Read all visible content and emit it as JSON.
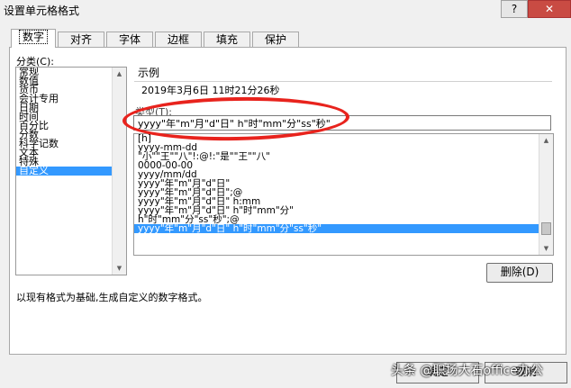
{
  "dialog": {
    "title": "设置单元格格式",
    "help": "?",
    "close": "✕"
  },
  "tabs": [
    "数字",
    "对齐",
    "字体",
    "边框",
    "填充",
    "保护"
  ],
  "category": {
    "label": "分类(C):",
    "items": [
      "常规",
      "数值",
      "货币",
      "会计专用",
      "日期",
      "时间",
      "百分比",
      "分数",
      "科学记数",
      "文本",
      "特殊",
      "自定义"
    ],
    "selected": "自定义"
  },
  "sample": {
    "legend": "示例",
    "value": "2019年3月6日 11时21分26秒"
  },
  "type": {
    "label": "类型(T):",
    "value": "yyyy\"年\"m\"月\"d\"日\" h\"时\"mm\"分\"ss\"秒\""
  },
  "formats": {
    "items": [
      "[h]",
      "yyyy-mm-dd",
      "\"小\"\"王\"\"八\"!:@!:\"是\"\"王\"\"八\"",
      "0000-00-00",
      "yyyy/mm/dd",
      "yyyy\"年\"m\"月\"d\"日\"",
      "yyyy\"年\"m\"月\"d\"日\";@",
      "yyyy\"年\"m\"月\"d\"日\" h:mm",
      "yyyy\"年\"m\"月\"d\"日\" h\"时\"mm\"分\"",
      "h\"时\"mm\"分\"ss\"秒\";@",
      "yyyy\"年\"m\"月\"d\"日\" h\"时\"mm\"分\"ss\"秒\""
    ],
    "selected_index": 10
  },
  "buttons": {
    "delete": "删除(D)",
    "ok": "确定",
    "cancel": "取消"
  },
  "description": "以现有格式为基础,生成自定义的数字格式。",
  "watermark": "头条 @职场大石office办公",
  "colors": {
    "selection": "#3399ff",
    "annotation": "#e8231d"
  }
}
